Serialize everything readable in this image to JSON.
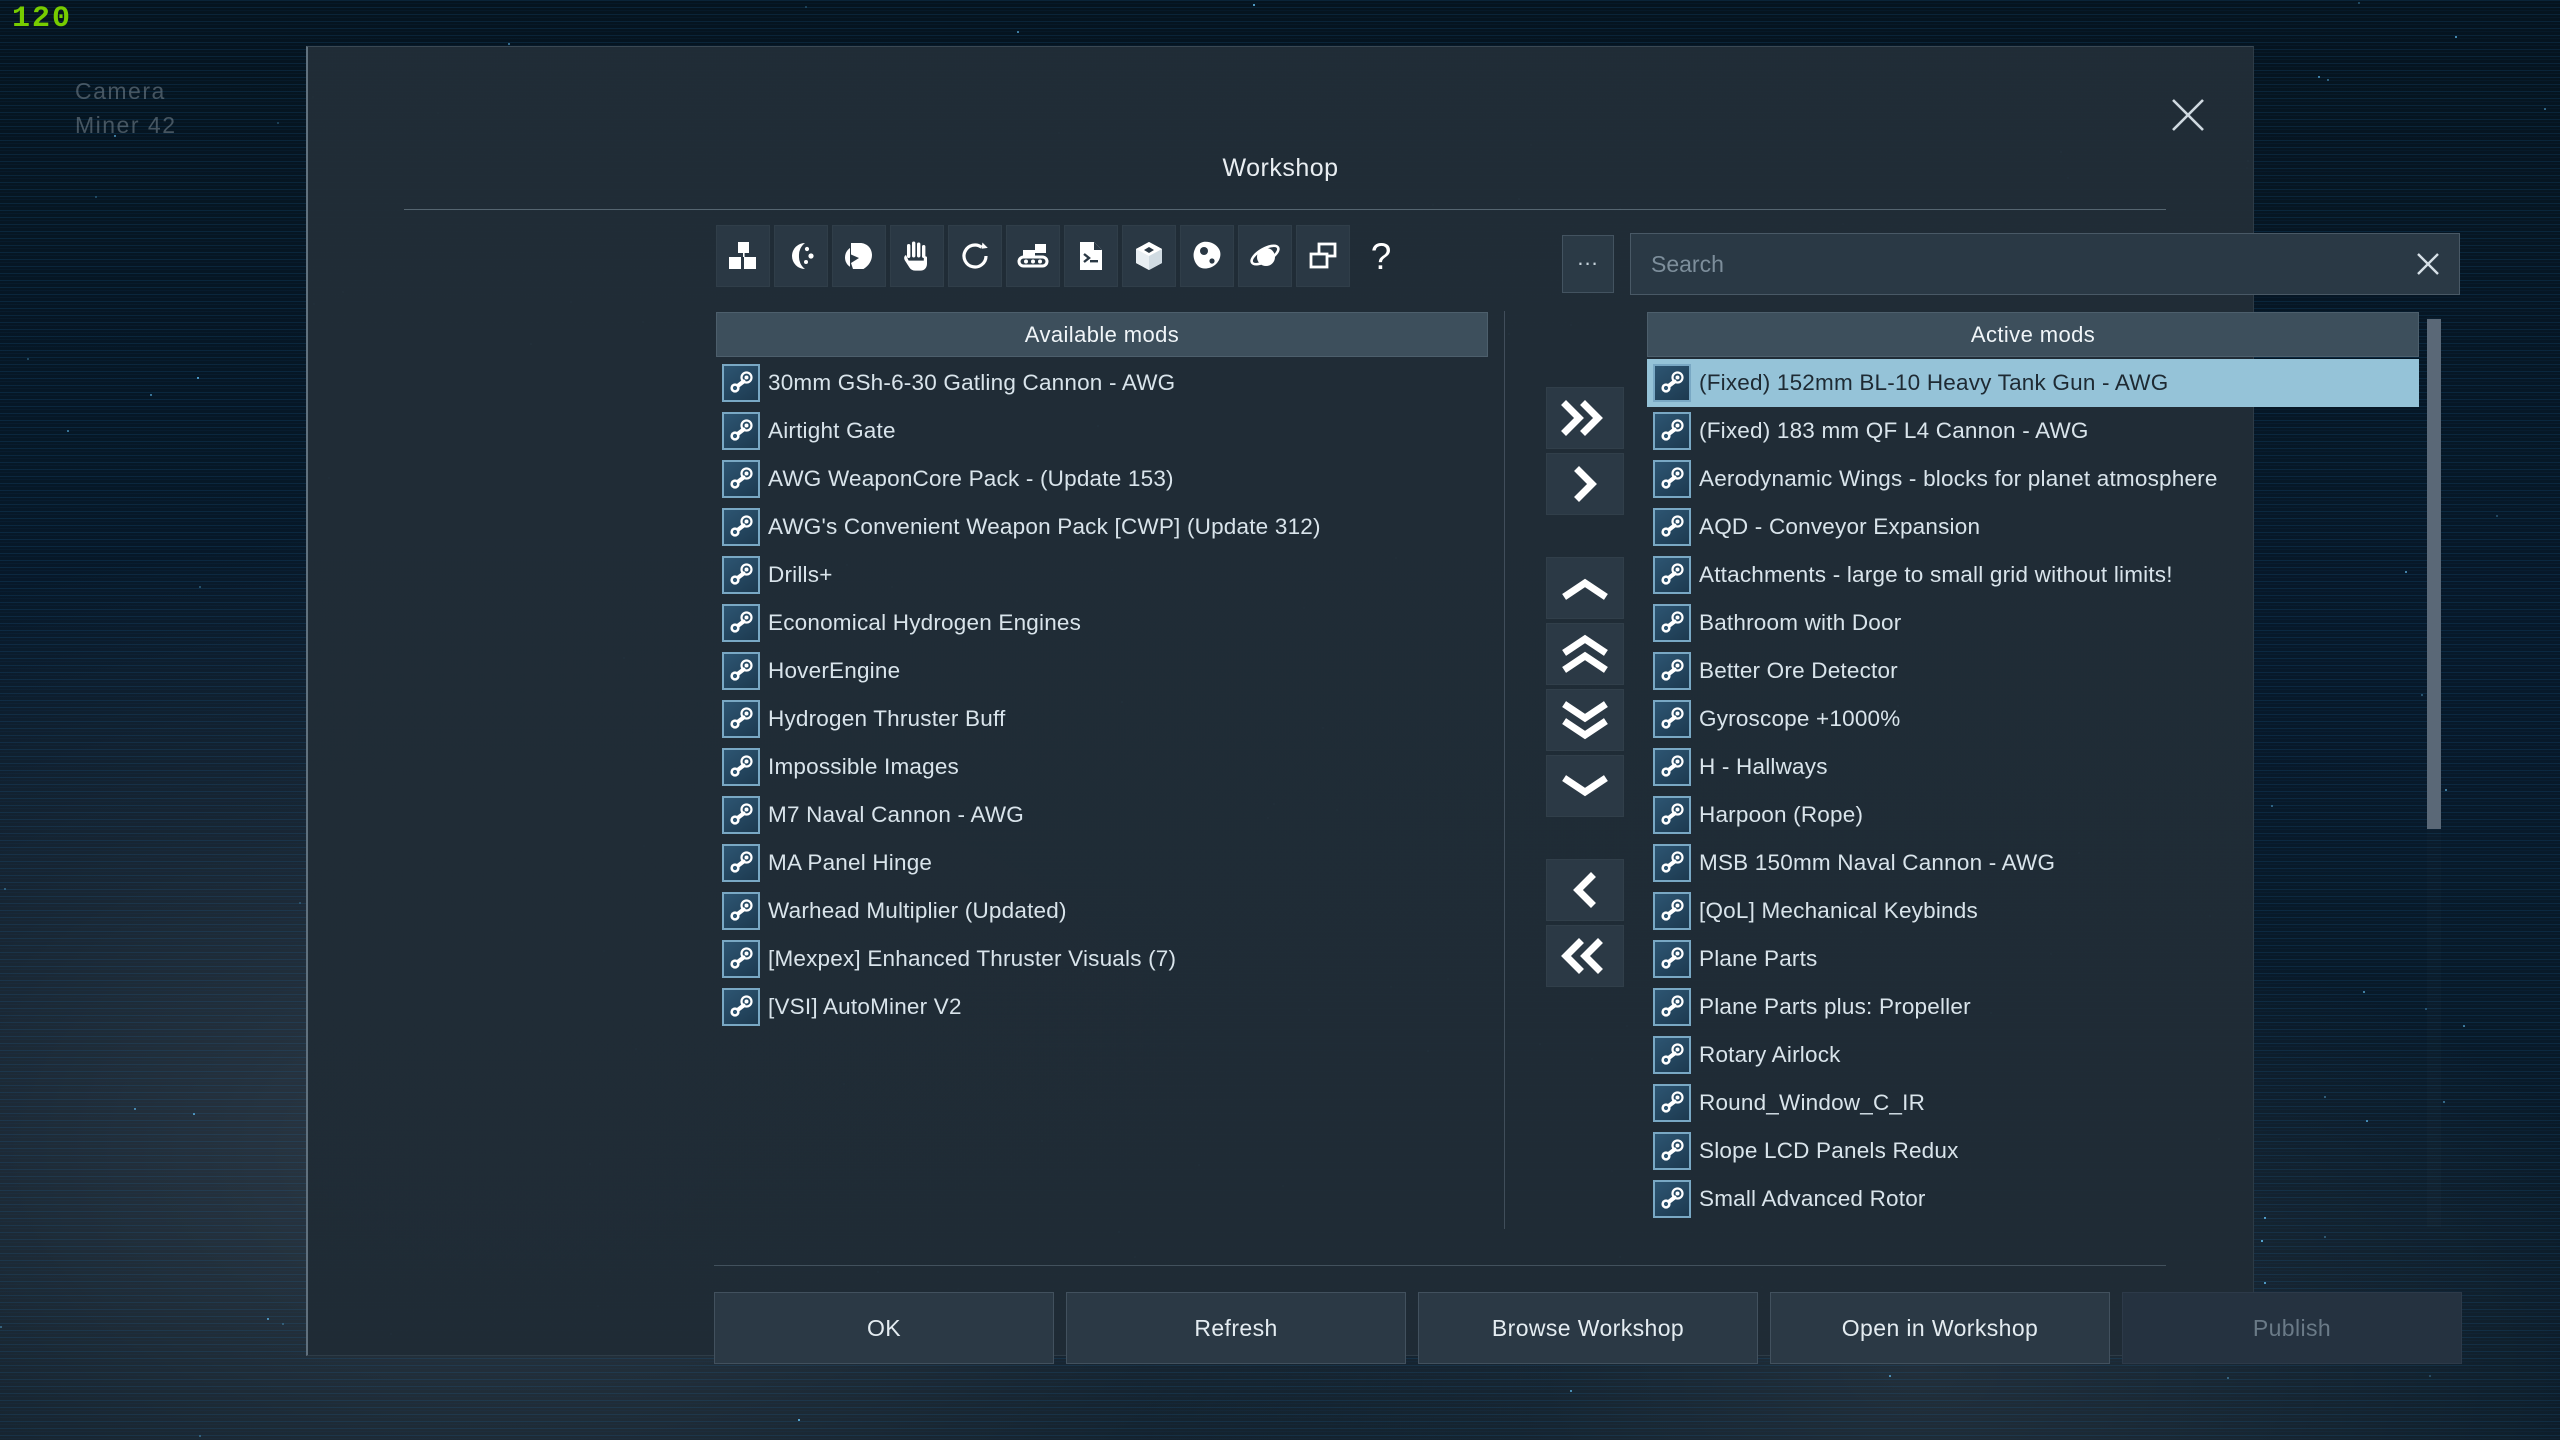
{
  "hud": {
    "fps": "120",
    "camera_label": "Camera",
    "camera_name": "Miner 42"
  },
  "dialog": {
    "title": "Workshop",
    "close_icon": "close-icon"
  },
  "toolbar": {
    "items": [
      {
        "icon": "blocks-icon",
        "name": "category-blocks"
      },
      {
        "icon": "moon-icon",
        "name": "category-moon"
      },
      {
        "icon": "helmet-icon",
        "name": "category-character"
      },
      {
        "icon": "hand-icon",
        "name": "category-animation"
      },
      {
        "icon": "rotate-icon",
        "name": "category-respawn"
      },
      {
        "icon": "vehicle-icon",
        "name": "category-vehicle"
      },
      {
        "icon": "script-file-icon",
        "name": "category-script"
      },
      {
        "icon": "cube-icon",
        "name": "category-model"
      },
      {
        "icon": "asteroid-icon",
        "name": "category-asteroid"
      },
      {
        "icon": "planet-icon",
        "name": "category-planet"
      },
      {
        "icon": "windows-icon",
        "name": "category-other"
      },
      {
        "icon": "question-icon",
        "name": "category-help"
      }
    ]
  },
  "search": {
    "more_label": "...",
    "placeholder": "Search",
    "value": "",
    "clear_icon": "close-icon"
  },
  "panels": {
    "available_header": "Available mods",
    "active_header": "Active mods"
  },
  "available_mods": [
    "30mm GSh-6-30 Gatling Cannon - AWG",
    "Airtight Gate",
    "AWG WeaponCore Pack - (Update 153)",
    "AWG's Convenient Weapon Pack [CWP] (Update 312)",
    "Drills+",
    "Economical Hydrogen Engines",
    "HoverEngine",
    "Hydrogen Thruster Buff",
    "Impossible Images",
    "M7 Naval Cannon - AWG",
    "MA Panel Hinge",
    "Warhead Multiplier (Updated)",
    "[Mexpex] Enhanced Thruster Visuals (7)",
    "[VSI] AutoMiner V2"
  ],
  "active_mods": [
    "(Fixed) 152mm BL-10 Heavy Tank Gun - AWG",
    "(Fixed) 183 mm QF L4 Cannon - AWG",
    "Aerodynamic Wings - blocks for planet atmosphere",
    "AQD - Conveyor Expansion",
    "Attachments - large to small grid without limits!",
    "Bathroom with Door",
    "Better Ore Detector",
    "Gyroscope +1000%",
    "H - Hallways",
    "Harpoon (Rope)",
    "MSB 150mm Naval Cannon - AWG",
    "[QoL] Mechanical Keybinds",
    "Plane Parts",
    "Plane Parts plus: Propeller",
    "Rotary Airlock",
    "Round_Window_C_IR",
    "Slope LCD Panels Redux",
    "Small Advanced Rotor"
  ],
  "selected_active_index": 0,
  "arrows": [
    {
      "icon": "double-chevron-right-icon",
      "name": "move-all-right-button"
    },
    {
      "icon": "chevron-right-icon",
      "name": "move-right-button"
    },
    {
      "icon": "chevron-up-icon",
      "name": "move-up-button"
    },
    {
      "icon": "double-chevron-up-icon",
      "name": "move-top-button"
    },
    {
      "icon": "double-chevron-down-icon",
      "name": "move-bottom-button"
    },
    {
      "icon": "chevron-down-icon",
      "name": "move-down-button"
    },
    {
      "icon": "chevron-left-icon",
      "name": "move-left-button"
    },
    {
      "icon": "double-chevron-left-icon",
      "name": "move-all-left-button"
    }
  ],
  "buttons": {
    "ok": "OK",
    "refresh": "Refresh",
    "browse_workshop": "Browse Workshop",
    "open_in_workshop": "Open in Workshop",
    "publish": "Publish",
    "publish_disabled": true
  },
  "colors": {
    "dialog_bg": "#212d37",
    "panel_header": "#3d4f5c",
    "selection": "#95c3d8",
    "button_bg": "#2b3945",
    "text": "#d9e4eb",
    "fps_green": "#77cc00",
    "steam_badge_border": "#79a8c4"
  }
}
